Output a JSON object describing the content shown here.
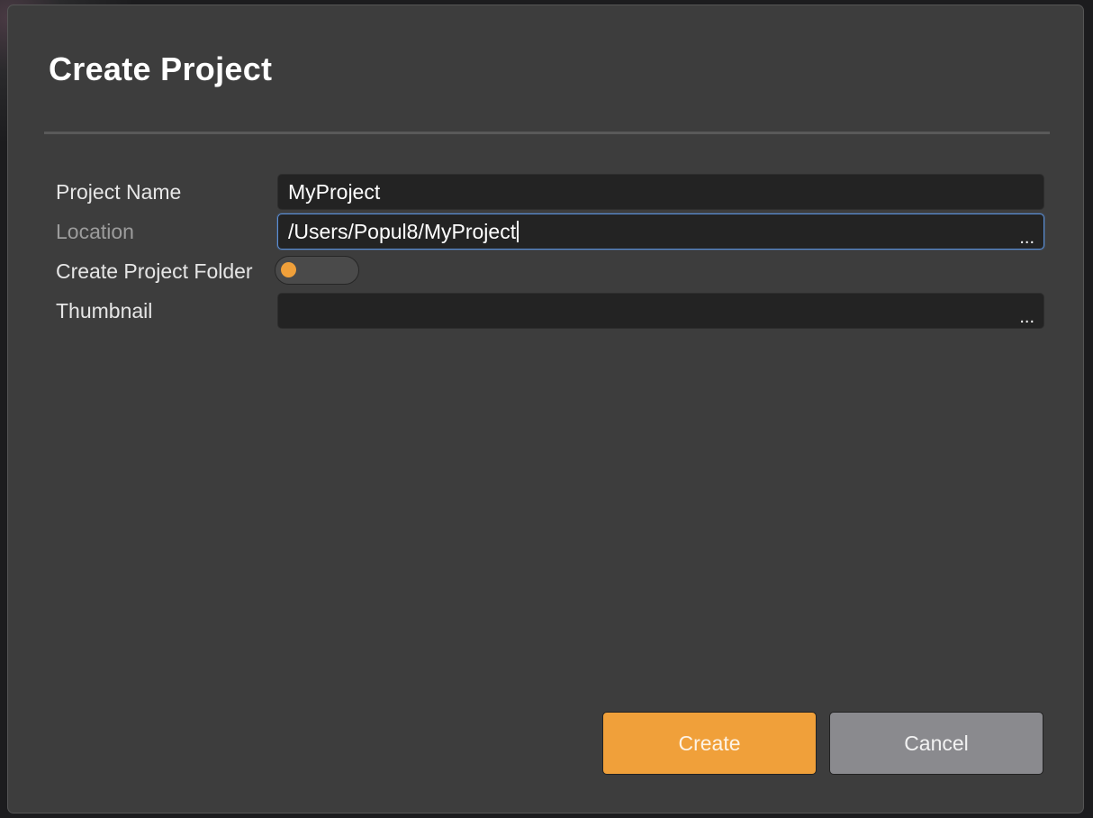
{
  "dialog": {
    "title": "Create Project"
  },
  "form": {
    "project_name": {
      "label": "Project Name",
      "value": "MyProject"
    },
    "location": {
      "label": "Location",
      "value": "/Users/Popul8/MyProject",
      "browse": "..."
    },
    "create_folder": {
      "label": "Create Project Folder",
      "enabled": false
    },
    "thumbnail": {
      "label": "Thumbnail",
      "value": "",
      "browse": "..."
    }
  },
  "buttons": {
    "create_label": "Create",
    "cancel_label": "Cancel"
  },
  "colors": {
    "accent": "#f0a03a",
    "dialog_bg": "#3d3d3d",
    "field_bg": "#232323",
    "focus_border": "#5a8ed6",
    "cancel_bg": "#8a8a8e"
  }
}
